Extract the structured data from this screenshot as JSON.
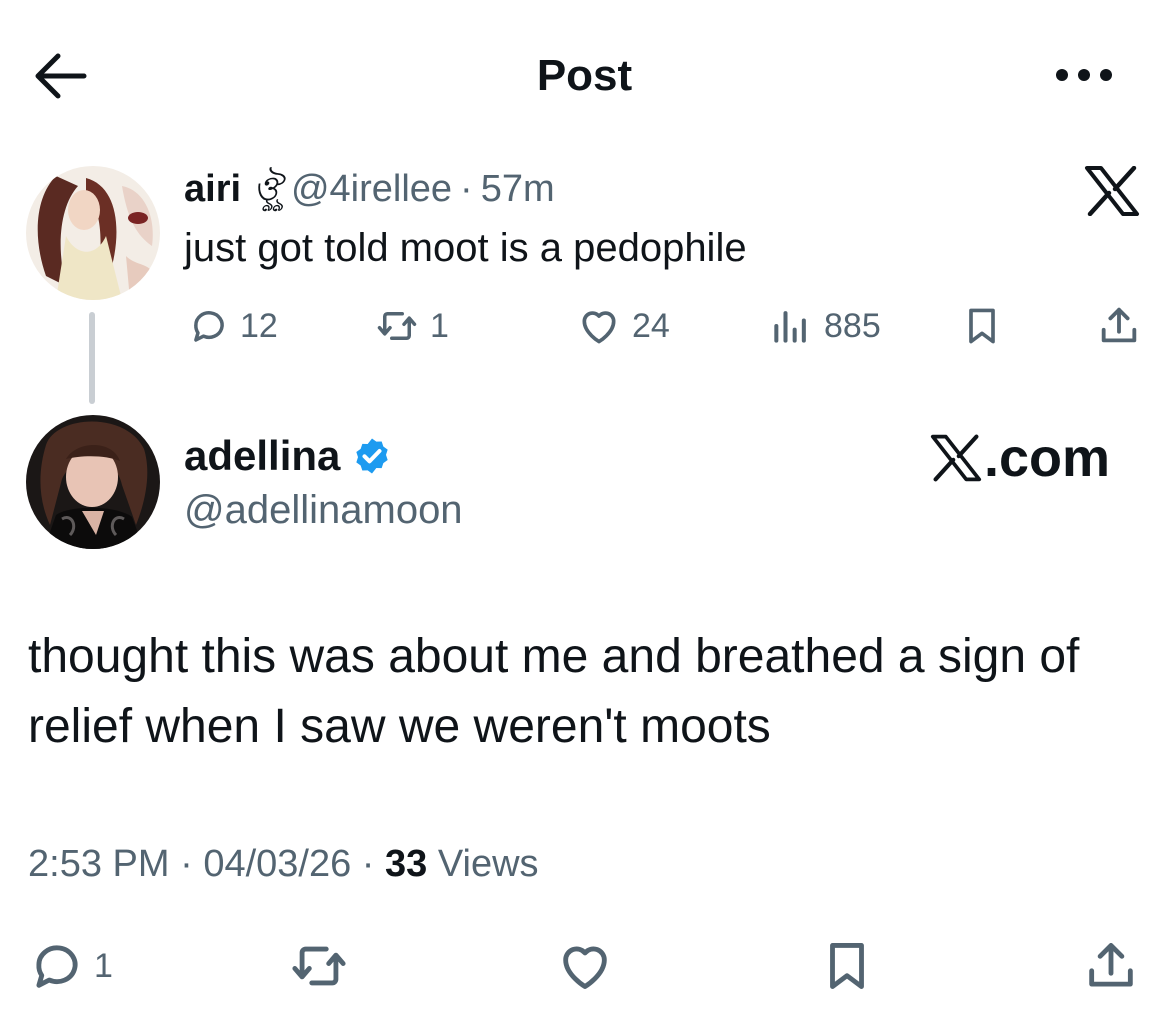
{
  "header": {
    "title": "Post",
    "back_icon": "arrow-left-icon",
    "more_icon": "more-horizontal-icon"
  },
  "parent_tweet": {
    "name": "airi",
    "name_emoji": "ঔৣ",
    "handle": "@4irellee",
    "separator": "·",
    "time": "57m",
    "text": "just got told moot is a pedophile",
    "brand_icon": "x-logo-icon",
    "actions": {
      "replies": "12",
      "reposts": "1",
      "likes": "24",
      "views": "885"
    }
  },
  "main_tweet": {
    "name": "adellina",
    "verified_icon": "verified-badge-icon",
    "handle": "@adellinamoon",
    "watermark": ".com",
    "text": "thought this was about me and breathed a sign of relief when I saw we weren't moots",
    "time": "2:53 PM",
    "separator": "·",
    "date": "04/03/26",
    "view_count": "33",
    "views_label": "Views",
    "actions": {
      "replies": "1"
    }
  },
  "colors": {
    "text": "#0f1419",
    "secondary": "#536471",
    "verified": "#1d9bf0",
    "thread_line": "#c9ced3"
  }
}
